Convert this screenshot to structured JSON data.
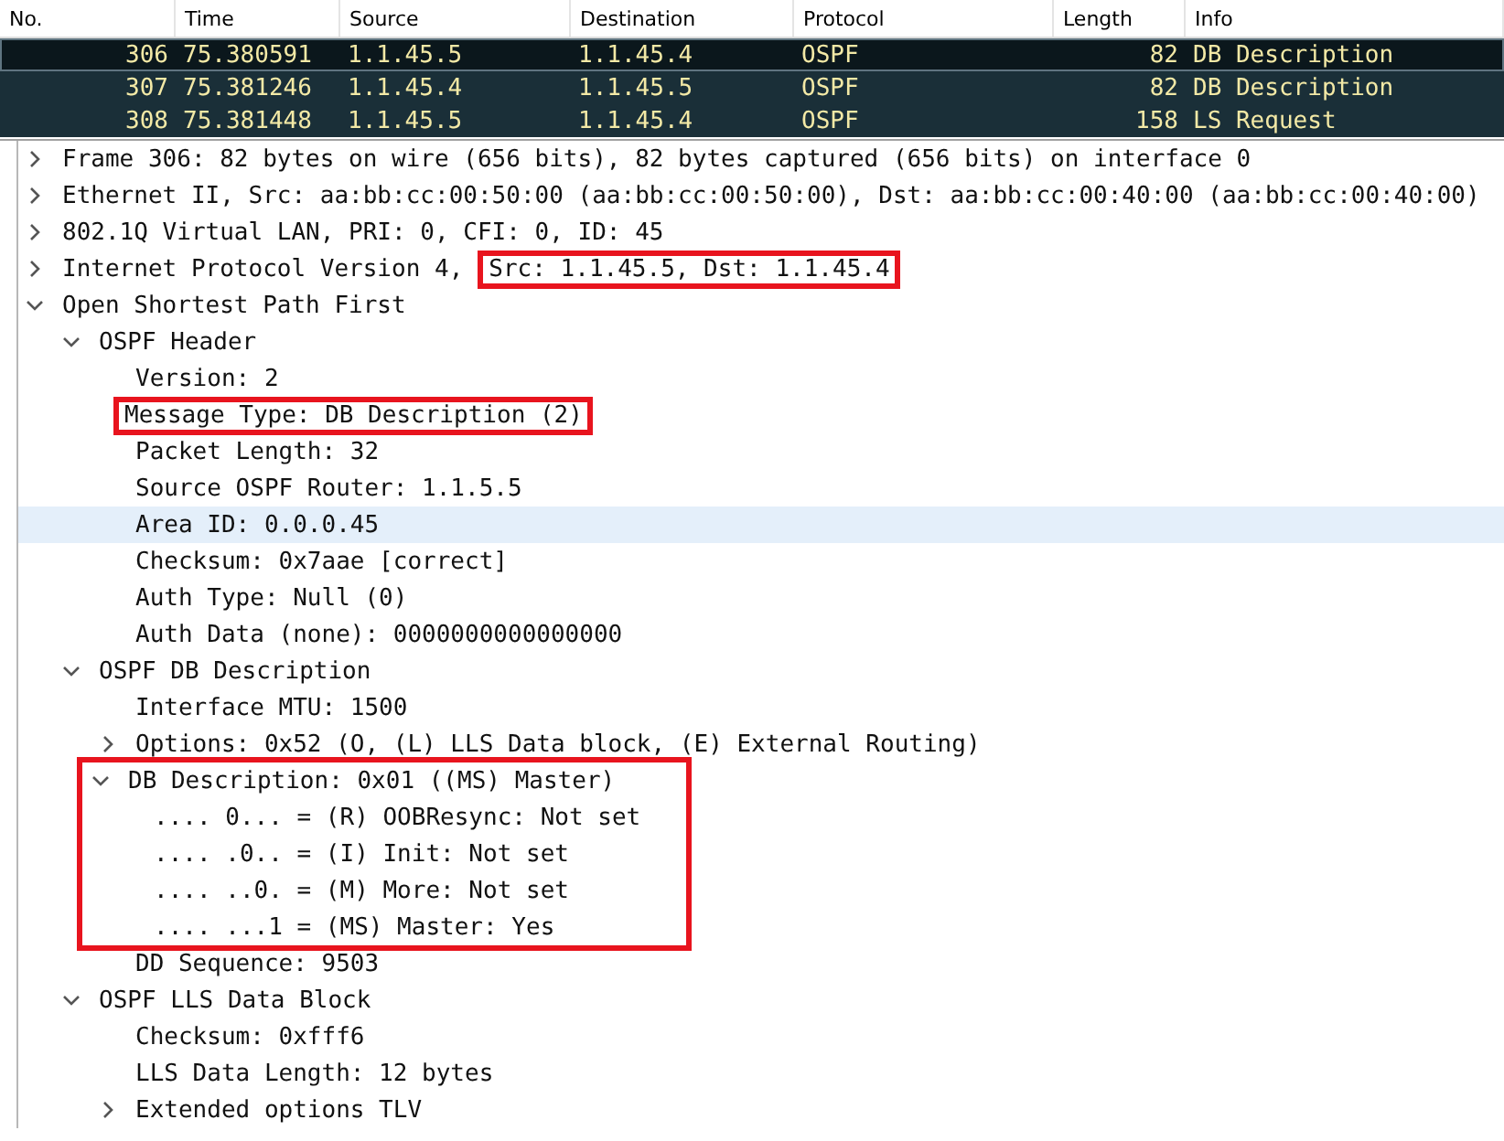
{
  "packet_list": {
    "columns": [
      "No.",
      "Time",
      "Source",
      "Destination",
      "Protocol",
      "Length",
      "Info"
    ],
    "rows": [
      {
        "selected": true,
        "cells": [
          "306",
          "75.380591",
          "1.1.45.5",
          "1.1.45.4",
          "OSPF",
          "82",
          "DB Description"
        ]
      },
      {
        "selected": false,
        "cells": [
          "307",
          "75.381246",
          "1.1.45.4",
          "1.1.45.5",
          "OSPF",
          "82",
          "DB Description"
        ]
      },
      {
        "selected": false,
        "cells": [
          "308",
          "75.381448",
          "1.1.45.5",
          "1.1.45.4",
          "OSPF",
          "158",
          "LS Request"
        ]
      }
    ]
  },
  "details": [
    {
      "text": "Frame 306: 82 bytes on wire (656 bits), 82 bytes captured (656 bits) on interface 0",
      "expanded": false,
      "selected": false
    },
    {
      "text": "Ethernet II, Src: aa:bb:cc:00:50:00 (aa:bb:cc:00:50:00), Dst: aa:bb:cc:00:40:00 (aa:bb:cc:00:40:00)",
      "expanded": false,
      "selected": false
    },
    {
      "text": "802.1Q Virtual LAN, PRI: 0, CFI: 0, ID: 45",
      "expanded": false,
      "selected": false
    },
    {
      "text": "Internet Protocol Version 4,",
      "boxed_text": "Src: 1.1.45.5, Dst: 1.1.45.4",
      "expanded": false,
      "selected": false
    },
    {
      "text": "Open Shortest Path First",
      "expanded": true,
      "selected": false,
      "children": [
        {
          "text": "OSPF Header",
          "expanded": true,
          "selected": false,
          "children": [
            {
              "text": "Version: 2",
              "selected": false
            },
            {
              "text": "Message Type: DB Description (2)",
              "selected": false,
              "boxed": true
            },
            {
              "text": "Packet Length: 32",
              "selected": false
            },
            {
              "text": "Source OSPF Router: 1.1.5.5",
              "selected": false
            },
            {
              "text": "Area ID: 0.0.0.45",
              "selected": true
            },
            {
              "text": "Checksum: 0x7aae [correct]",
              "selected": false
            },
            {
              "text": "Auth Type: Null (0)",
              "selected": false
            },
            {
              "text": "Auth Data (none): 0000000000000000",
              "selected": false
            }
          ]
        },
        {
          "text": "OSPF DB Description",
          "expanded": true,
          "selected": false,
          "children": [
            {
              "text": "Interface MTU: 1500",
              "selected": false
            },
            {
              "text": "Options: 0x52 (O, (L) LLS Data block, (E) External Routing)",
              "expanded": false,
              "selected": false
            },
            {
              "text": "DB Description: 0x01 ((MS) Master)",
              "expanded": true,
              "selected": false,
              "boxed": true,
              "children": [
                {
                  "text": ".... 0... = (R) OOBResync: Not set",
                  "selected": false
                },
                {
                  "text": ".... .0.. = (I) Init: Not set",
                  "selected": false
                },
                {
                  "text": ".... ..0. = (M) More: Not set",
                  "selected": false
                },
                {
                  "text": ".... ...1 = (MS) Master: Yes",
                  "selected": false
                }
              ]
            },
            {
              "text": "DD Sequence: 9503",
              "selected": false
            }
          ]
        },
        {
          "text": "OSPF LLS Data Block",
          "expanded": true,
          "selected": false,
          "children": [
            {
              "text": "Checksum: 0xfff6",
              "selected": false
            },
            {
              "text": "LLS Data Length: 12 bytes",
              "selected": false
            },
            {
              "text": "Extended options TLV",
              "expanded": false,
              "selected": false
            }
          ]
        }
      ]
    }
  ]
}
